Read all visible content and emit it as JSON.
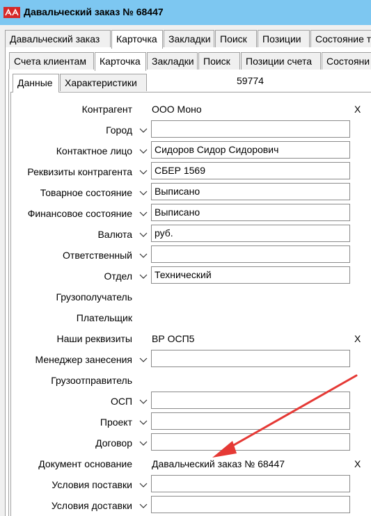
{
  "window": {
    "title": "Давальческий заказ № 68447"
  },
  "tabs_level1": [
    "Давальческий заказ",
    "Карточка",
    "Закладки",
    "Поиск",
    "Позиции",
    "Состояние т"
  ],
  "tabs_level2": [
    "Счета клиентам",
    "Карточка",
    "Закладки",
    "Поиск",
    "Позиции счета",
    "Состояни"
  ],
  "tabs_level3": [
    "Данные",
    "Характеристики"
  ],
  "record_id": "59774",
  "fields": {
    "kontragent": {
      "label": "Контрагент",
      "value": "ООО Моно",
      "clear": "X"
    },
    "gorod": {
      "label": "Город",
      "value": ""
    },
    "kontakt": {
      "label": "Контактное лицо",
      "value": "Сидоров Сидор Сидорович"
    },
    "rekvizity": {
      "label": "Реквизиты контрагента",
      "value": "СБЕР 1569"
    },
    "tovar_sost": {
      "label": "Товарное состояние",
      "value": "Выписано"
    },
    "fin_sost": {
      "label": "Финансовое состояние",
      "value": "Выписано"
    },
    "valyuta": {
      "label": "Валюта",
      "value": "руб."
    },
    "otvetstv": {
      "label": "Ответственный",
      "value": ""
    },
    "otdel": {
      "label": "Отдел",
      "value": "Технический"
    },
    "gruzopoluch": {
      "label": "Грузополучатель"
    },
    "platelshik": {
      "label": "Плательщик"
    },
    "nashi_rekv": {
      "label": "Наши реквизиты",
      "value": "ВР ОСП5",
      "clear": "X"
    },
    "menedzher": {
      "label": "Менеджер занесения",
      "value": ""
    },
    "gruzootpr": {
      "label": "Грузоотправитель"
    },
    "osp": {
      "label": "ОСП",
      "value": ""
    },
    "proekt": {
      "label": "Проект",
      "value": ""
    },
    "dogovor": {
      "label": "Договор",
      "value": ""
    },
    "dok_osnov": {
      "label": "Документ основание",
      "value": "Давальческий заказ № 68447",
      "clear": "X"
    },
    "usl_postavki": {
      "label": "Условия поставки",
      "value": ""
    },
    "usl_dostavki": {
      "label": "Условия доставки",
      "value": ""
    }
  },
  "colors": {
    "titlebar": "#7dc7f1",
    "arrow": "#e53935",
    "logo": "#d62828"
  },
  "icons": {
    "app": "app-logo-icon",
    "dropdown": "chevron-down-icon",
    "annotation": "red-arrow"
  }
}
